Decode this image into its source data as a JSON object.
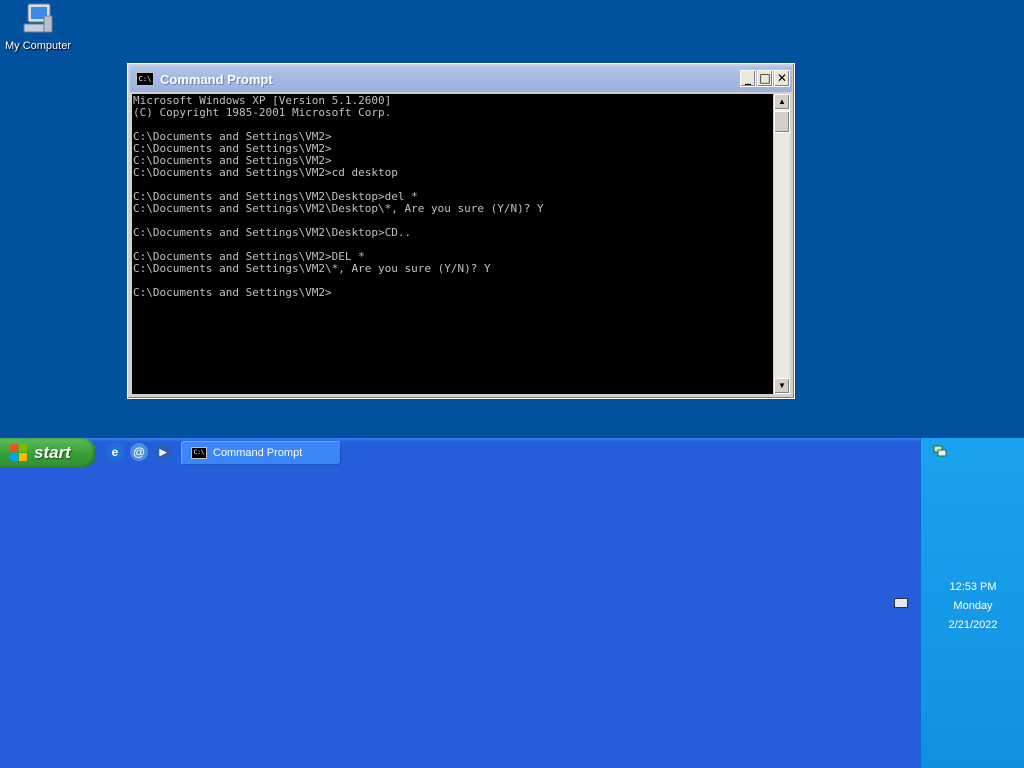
{
  "desktop": {
    "icons": [
      {
        "label": "My Computer",
        "icon": "my-computer-icon"
      }
    ]
  },
  "window": {
    "title": "Command Prompt",
    "icon_text": "C:\\",
    "buttons": {
      "minimize": "_",
      "maximize": "□",
      "close": "✕"
    },
    "terminal_lines": [
      "Microsoft Windows XP [Version 5.1.2600]",
      "(C) Copyright 1985-2001 Microsoft Corp.",
      "",
      "C:\\Documents and Settings\\VM2>",
      "C:\\Documents and Settings\\VM2>",
      "C:\\Documents and Settings\\VM2>",
      "C:\\Documents and Settings\\VM2>cd desktop",
      "",
      "C:\\Documents and Settings\\VM2\\Desktop>del *",
      "C:\\Documents and Settings\\VM2\\Desktop\\*, Are you sure (Y/N)? Y",
      "",
      "C:\\Documents and Settings\\VM2\\Desktop>CD..",
      "",
      "C:\\Documents and Settings\\VM2>DEL *",
      "C:\\Documents and Settings\\VM2\\*, Are you sure (Y/N)? Y",
      "",
      "C:\\Documents and Settings\\VM2>"
    ],
    "colors": {
      "terminal_bg": "#000000",
      "terminal_fg": "#c0c0c0"
    }
  },
  "taskbar": {
    "start_label": "start",
    "quick_launch": [
      {
        "name": "internet-explorer-icon",
        "glyph": "e"
      },
      {
        "name": "outlook-express-icon",
        "glyph": "@"
      },
      {
        "name": "media-player-icon",
        "glyph": "▶"
      }
    ],
    "tasks": [
      {
        "label": "Command Prompt",
        "icon_text": "C:\\"
      }
    ]
  },
  "tray": {
    "time": "12:53 PM",
    "day": "Monday",
    "date": "2/21/2022"
  }
}
